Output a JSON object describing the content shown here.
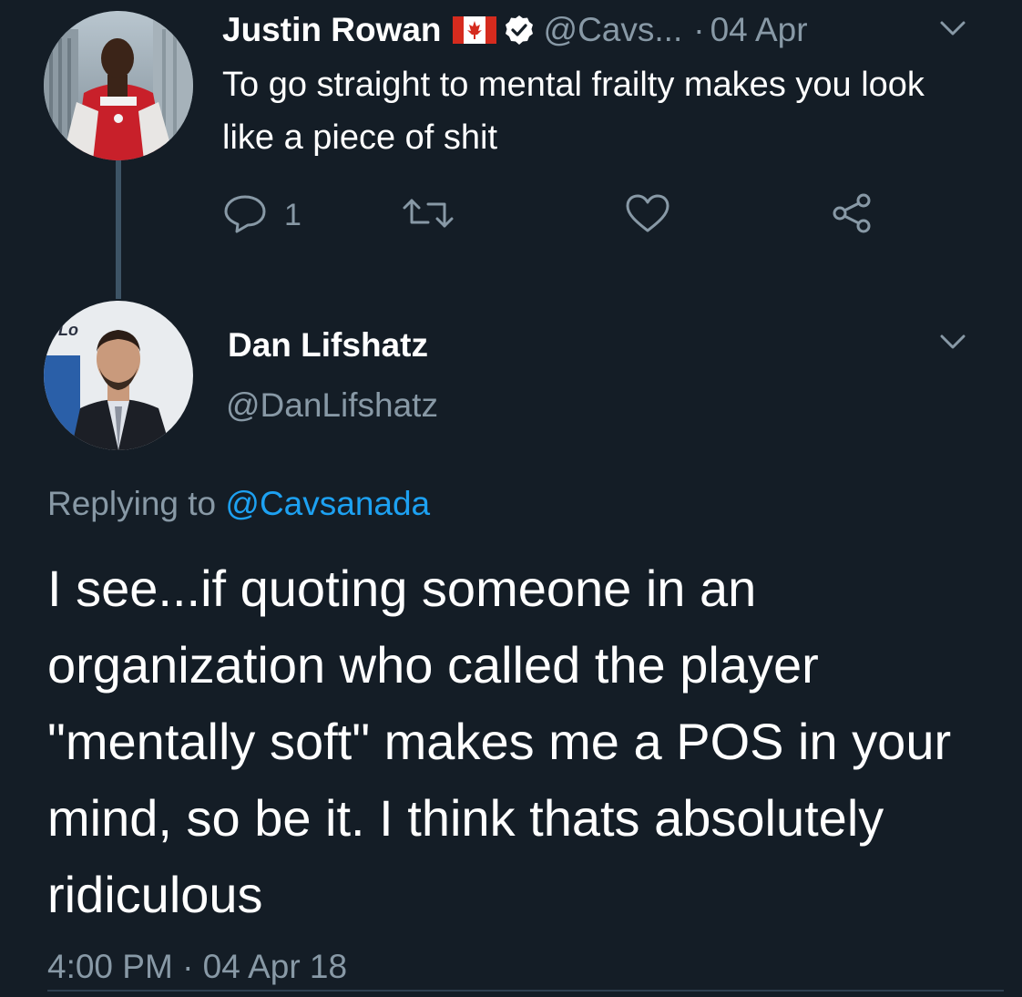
{
  "colors": {
    "background": "#141d26",
    "text_primary": "#ffffff",
    "text_secondary": "#8899a6",
    "link": "#1da1f2",
    "thread_line": "#3d5466"
  },
  "parent_tweet": {
    "author_name": "Justin Rowan",
    "flag_icon": "canada-flag-icon",
    "verified_icon": "verified-badge-icon",
    "handle": "@Cavs...",
    "separator": "·",
    "date": "04 Apr",
    "text": "To go straight to mental frailty makes you look like a piece of shit",
    "actions": {
      "reply_icon": "reply-icon",
      "reply_count": "1",
      "retweet_icon": "retweet-icon",
      "like_icon": "heart-icon",
      "share_icon": "share-icon"
    }
  },
  "main_tweet": {
    "author_name": "Dan Lifshatz",
    "handle": "@DanLifshatz",
    "replying_prefix": "Replying to",
    "replying_mention": "@Cavsanada",
    "text": "I see...if quoting someone in an organization who called the player \"mentally soft\" makes me a POS in your mind, so be it. I think thats absolutely ridiculous",
    "timestamp": "4:00 PM · 04 Apr 18"
  }
}
